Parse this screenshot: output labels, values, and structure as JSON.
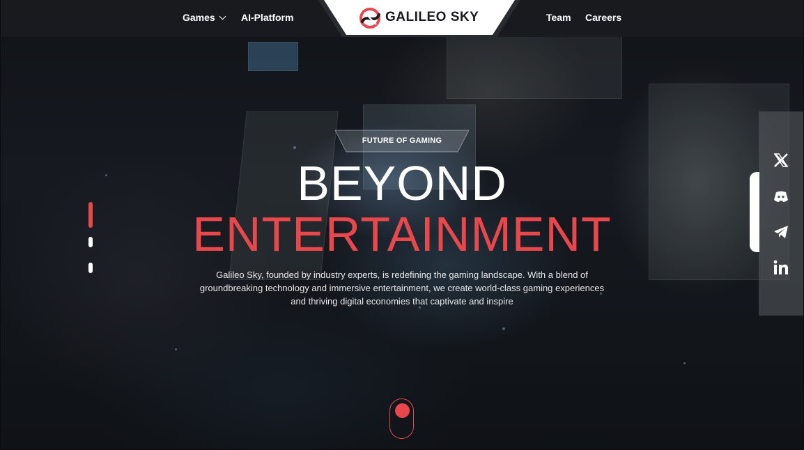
{
  "header": {
    "nav_left": [
      {
        "label": "Games",
        "has_dropdown": true
      },
      {
        "label": "AI-Platform",
        "has_dropdown": false
      }
    ],
    "nav_right": [
      {
        "label": "Team"
      },
      {
        "label": "Careers"
      }
    ],
    "logo": {
      "text": "GALILEO SKY"
    }
  },
  "hero": {
    "badge": "FUTURE OF GAMING",
    "title_line1": "BEYOND",
    "title_line2": "ENTERTAINMENT",
    "description": "Galileo Sky, founded by industry experts, is redefining the gaming landscape. With a blend of groundbreaking technology and immersive entertainment, we create world-class gaming experiences and thriving digital economies that captivate and inspire"
  },
  "slider": {
    "slides": 3,
    "active_index": 0
  },
  "social": [
    {
      "icon": "x-icon"
    },
    {
      "icon": "discord-icon"
    },
    {
      "icon": "telegram-icon"
    },
    {
      "icon": "linkedin-icon"
    }
  ],
  "colors": {
    "accent": "#e8474c",
    "header_bg": "#1a1b1f",
    "text": "#ffffff"
  }
}
